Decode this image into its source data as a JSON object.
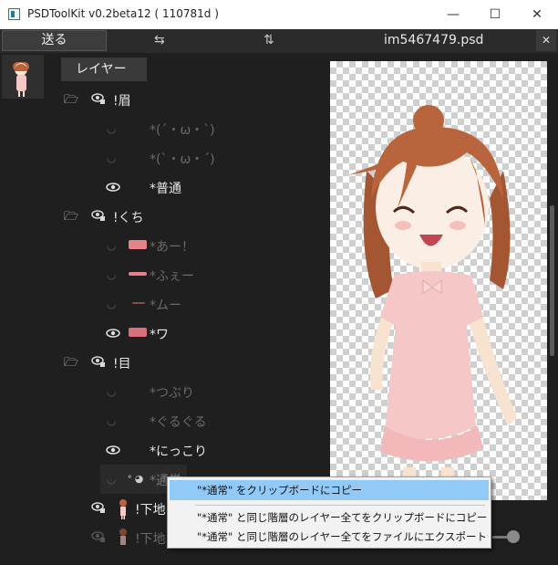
{
  "window": {
    "title": "PSDToolKit v0.2beta12 ( 110781d )",
    "minimize": "—",
    "maximize": "☐",
    "close": "✕"
  },
  "toolbar": {
    "send_label": "送る",
    "swap_horizontal": "⇆",
    "swap_vertical": "⇅",
    "file_name": "im5467479.psd",
    "close_label": "✕"
  },
  "layer_panel": {
    "tab_label": "レイヤー",
    "groups": [
      {
        "name": "!眉",
        "items": [
          "*(´・ω・`)",
          "*(`・ω・´)",
          "*普通"
        ]
      },
      {
        "name": "!くち",
        "items": [
          "*あー！",
          "*ふぇー",
          "*ムー",
          "*ワ"
        ]
      },
      {
        "name": "!目",
        "items": [
          "*つぶり",
          "*ぐるぐる",
          "*にっこり",
          "*通常"
        ]
      }
    ],
    "bottom_layers": [
      "!下地",
      "!下地"
    ]
  },
  "context_menu": {
    "items": [
      "\"*通常\" をクリップボードにコピー",
      "\"*通常\" と同じ階層のレイヤー全てをクリップボードにコピー",
      "\"*通常\" と同じ階層のレイヤー全てをファイルにエクスポート"
    ]
  },
  "colors": {
    "background": "#1f1f1f",
    "menu_highlight": "#91c9f7",
    "hair": "#b8643c",
    "dress": "#f6c7c7"
  }
}
